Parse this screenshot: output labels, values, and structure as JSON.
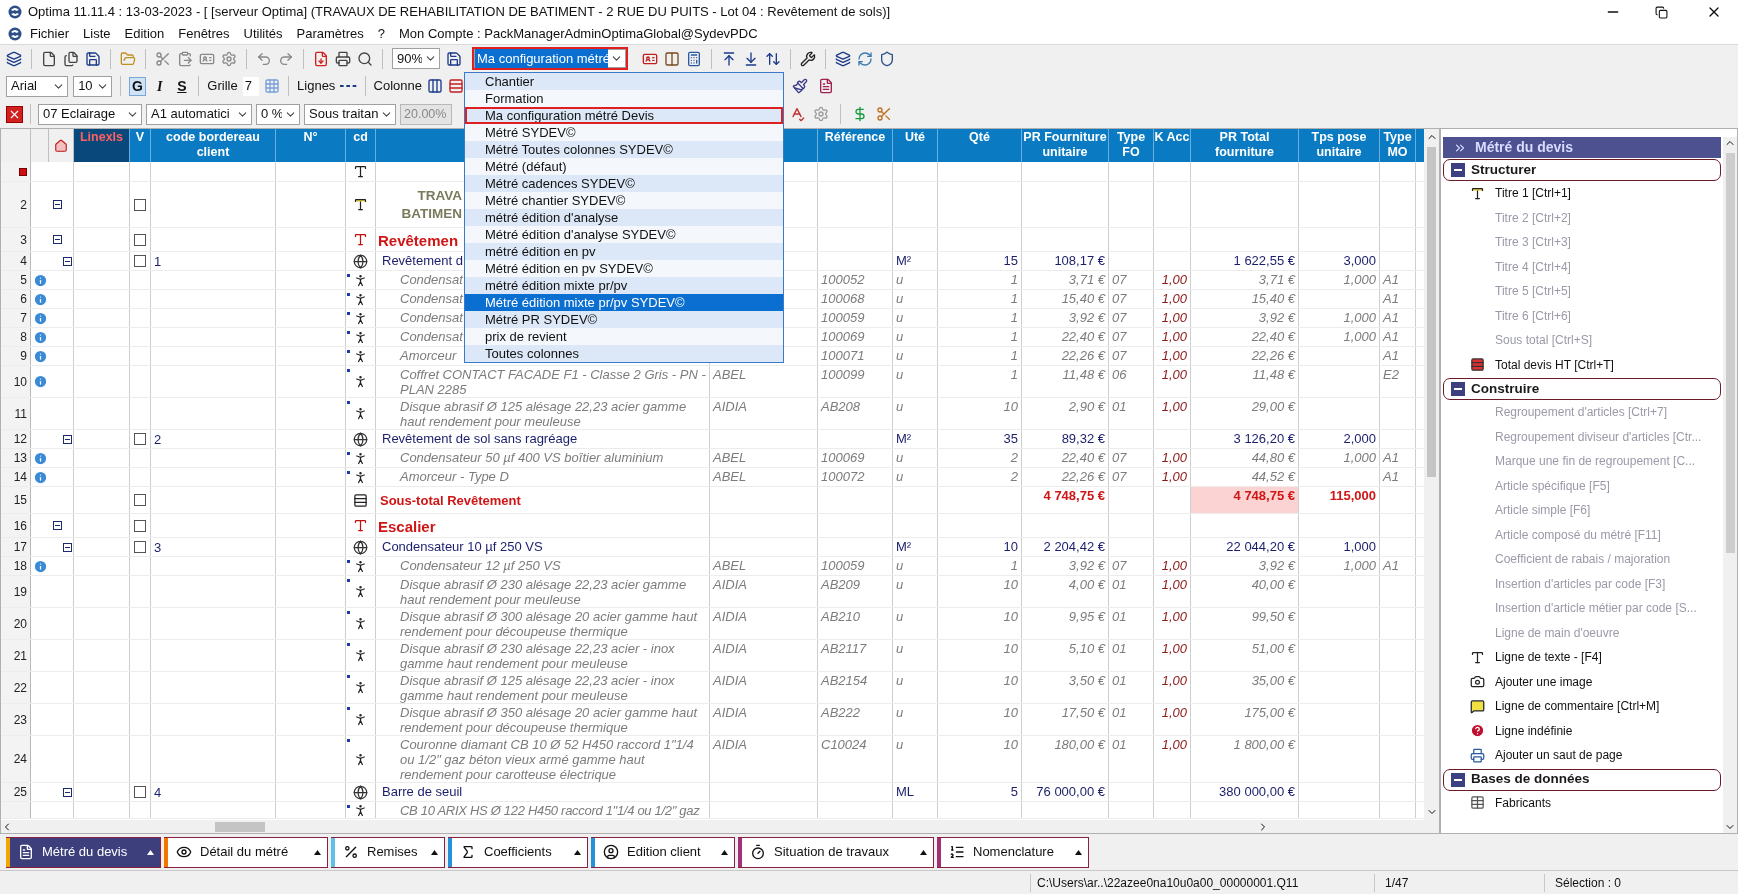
{
  "window": {
    "title": "Optima 11.11.4 : 13-03-2023 - [ [serveur Optima] (TRAVAUX DE REHABILITATION DE BATIMENT - 2 RUE DU PUITS - Lot 04 : Revêtement de sols)]"
  },
  "menu": [
    "Fichier",
    "Liste",
    "Edition",
    "Fenêtres",
    "Utilités",
    "Paramètres",
    "?"
  ],
  "account": "Mon Compte : PackManagerAdminOptimaGlobal@SydevPDC",
  "toolbar": {
    "zoom": "90%",
    "configuration": {
      "value": "Ma configuration métré",
      "outlined": true
    },
    "font": "Arial",
    "font_size": "10",
    "styles": [
      {
        "label": "G",
        "pressed": true
      },
      {
        "label": "I",
        "pressed": false
      },
      {
        "label": "S",
        "pressed": false
      }
    ],
    "grid_label": "Grille",
    "grid_value": "7",
    "lines_label": "Lignes",
    "column_label": "Colonne",
    "lot": "07  Eclairage",
    "mo_type": "A1  automatici",
    "rate": "0 %",
    "subcontract": "Sous traitan",
    "percent": "20.00%"
  },
  "config_menu": [
    {
      "label": "Chantier",
      "selected": false,
      "outlined": false
    },
    {
      "label": "Formation",
      "selected": false,
      "outlined": false
    },
    {
      "label": "Ma configuration métré Devis",
      "selected": false,
      "outlined": true
    },
    {
      "label": "Métré  SYDEV©",
      "selected": false,
      "outlined": false
    },
    {
      "label": "Métré  Toutes colonnes SYDEV©",
      "selected": false,
      "outlined": false
    },
    {
      "label": "Métré (défaut)",
      "selected": false,
      "outlined": false
    },
    {
      "label": "Métré cadences SYDEV©",
      "selected": false,
      "outlined": false
    },
    {
      "label": "Métré chantier SYDEV©",
      "selected": false,
      "outlined": false
    },
    {
      "label": "métré édition d'analyse",
      "selected": false,
      "outlined": false
    },
    {
      "label": "Métré édition d'analyse SYDEV©",
      "selected": false,
      "outlined": false
    },
    {
      "label": "métré édition en pv",
      "selected": false,
      "outlined": false
    },
    {
      "label": "Métré édition en pv SYDEV©",
      "selected": false,
      "outlined": false
    },
    {
      "label": "métré édition mixte pr/pv",
      "selected": false,
      "outlined": false
    },
    {
      "label": "Métré édition mixte pr/pv SYDEV©",
      "selected": true,
      "outlined": false
    },
    {
      "label": "Métré PR SYDEV©",
      "selected": false,
      "outlined": false
    },
    {
      "label": "prix de revient",
      "selected": false,
      "outlined": false
    },
    {
      "label": "Toutes colonnes",
      "selected": false,
      "outlined": false
    }
  ],
  "table": {
    "columns": [
      "Linexls",
      "V",
      "code bordereau client",
      "N°",
      "cd",
      "Référence",
      "Uté",
      "Qté",
      "PR Fourniture unitaire",
      "Type FO",
      "K Acc",
      "PR Total fourniture",
      "Tps pose unitaire",
      "Type MO"
    ],
    "rows": [
      {
        "kind": "text",
        "current": true,
        "info": false
      },
      {
        "num": "2",
        "kind": "title1",
        "current": false,
        "info": false,
        "checked": false,
        "designation_lines": [
          "TRAVA",
          "BATIMEN"
        ]
      },
      {
        "num": "3",
        "kind": "title2",
        "current": false,
        "info": false,
        "checked": false,
        "designation": "Revêtemen"
      },
      {
        "num": "4",
        "kind": "ouvrage",
        "current": false,
        "info": false,
        "checked": false,
        "code": "1",
        "designation": "Revêtement d",
        "unit": "M²",
        "qty": "15",
        "unit_price": "108,17 €",
        "total": "1 622,55 €",
        "time": "3,000"
      },
      {
        "num": "5",
        "kind": "article",
        "current": false,
        "info": true,
        "designation": "Condensat",
        "ref": "100052",
        "unit": "u",
        "qty": "1",
        "unit_price": "3,71 €",
        "type_fo": "07",
        "k_acc": "1,00",
        "total": "3,71 €",
        "time": "1,000",
        "type_mo": "A1"
      },
      {
        "num": "6",
        "kind": "article",
        "current": false,
        "info": true,
        "designation": "Condensat",
        "ref": "100068",
        "unit": "u",
        "qty": "1",
        "unit_price": "15,40 €",
        "type_fo": "07",
        "k_acc": "1,00",
        "total": "15,40 €",
        "type_mo": "A1"
      },
      {
        "num": "7",
        "kind": "article",
        "current": false,
        "info": true,
        "designation": "Condensat",
        "ref": "100059",
        "unit": "u",
        "qty": "1",
        "unit_price": "3,92 €",
        "type_fo": "07",
        "k_acc": "1,00",
        "total": "3,92 €",
        "time": "1,000",
        "type_mo": "A1"
      },
      {
        "num": "8",
        "kind": "article",
        "current": false,
        "info": true,
        "designation": "Condensat",
        "ref": "100069",
        "unit": "u",
        "qty": "1",
        "unit_price": "22,40 €",
        "type_fo": "07",
        "k_acc": "1,00",
        "total": "22,40 €",
        "time": "1,000",
        "type_mo": "A1"
      },
      {
        "num": "9",
        "kind": "article",
        "current": false,
        "info": true,
        "designation": "Amorceur",
        "ref": "100071",
        "unit": "u",
        "qty": "1",
        "unit_price": "22,26 €",
        "type_fo": "07",
        "k_acc": "1,00",
        "total": "22,26 €",
        "type_mo": "A1"
      },
      {
        "num": "10",
        "kind": "article",
        "current": false,
        "info": true,
        "designation": "Coffret CONTACT FACADE F1 - Classe 2 Gris - PN - PLAN 2285",
        "supplier": "ABEL",
        "ref": "100099",
        "unit": "u",
        "qty": "1",
        "unit_price": "11,48 €",
        "type_fo": "06",
        "k_acc": "1,00",
        "total": "11,48 €",
        "type_mo": "E2"
      },
      {
        "num": "11",
        "kind": "article",
        "current": false,
        "info": false,
        "designation": "Disque abrasif Ø 125 alésage 22,23 acier gamme haut rendement pour meuleuse",
        "supplier": "AIDIA",
        "ref": "AB208",
        "unit": "u",
        "qty": "10",
        "unit_price": "2,90 €",
        "type_fo": "01",
        "k_acc": "1,00",
        "total": "29,00 €"
      },
      {
        "num": "12",
        "kind": "ouvrage",
        "current": false,
        "info": false,
        "checked": false,
        "code": "2",
        "designation": "Revêtement de sol sans ragréage",
        "unit": "M²",
        "qty": "35",
        "unit_price": "89,32 €",
        "total": "3 126,20 €",
        "time": "2,000"
      },
      {
        "num": "13",
        "kind": "article",
        "current": false,
        "info": true,
        "designation": "Condensateur 50 µf 400 VS boîtier aluminium",
        "supplier": "ABEL",
        "ref": "100069",
        "unit": "u",
        "qty": "2",
        "unit_price": "22,40 €",
        "type_fo": "07",
        "k_acc": "1,00",
        "total": "44,80 €",
        "time": "1,000",
        "type_mo": "A1"
      },
      {
        "num": "14",
        "kind": "article",
        "current": false,
        "info": true,
        "designation": "Amorceur  - Type D",
        "supplier": "ABEL",
        "ref": "100072",
        "unit": "u",
        "qty": "2",
        "unit_price": "22,26 €",
        "type_fo": "07",
        "k_acc": "1,00",
        "total": "44,52 €",
        "type_mo": "A1"
      },
      {
        "num": "15",
        "kind": "subtotal",
        "current": false,
        "info": false,
        "checked": false,
        "designation": "Sous-total Revêtement",
        "unit_price": "4 748,75 €",
        "total": "4 748,75 €",
        "time": "115,000"
      },
      {
        "num": "16",
        "kind": "title2",
        "current": false,
        "info": false,
        "checked": false,
        "designation": "Escalier"
      },
      {
        "num": "17",
        "kind": "ouvrage",
        "current": false,
        "info": false,
        "checked": false,
        "code": "3",
        "designation": "Condensateur 10 µf 250 VS",
        "unit": "M²",
        "qty": "10",
        "unit_price": "2 204,42 €",
        "total": "22 044,20 €",
        "time": "1,000"
      },
      {
        "num": "18",
        "kind": "article",
        "current": false,
        "info": true,
        "designation": "Condensateur 12 µf 250 VS",
        "supplier": "ABEL",
        "ref": "100059",
        "unit": "u",
        "qty": "1",
        "unit_price": "3,92 €",
        "type_fo": "07",
        "k_acc": "1,00",
        "total": "3,92 €",
        "time": "1,000",
        "type_mo": "A1"
      },
      {
        "num": "19",
        "kind": "article",
        "current": false,
        "info": false,
        "designation": "Disque abrasif Ø 230 alésage 22,23 acier gamme haut rendement pour meuleuse",
        "supplier": "AIDIA",
        "ref": "AB209",
        "unit": "u",
        "qty": "10",
        "unit_price": "4,00 €",
        "type_fo": "01",
        "k_acc": "1,00",
        "total": "40,00 €"
      },
      {
        "num": "20",
        "kind": "article",
        "current": false,
        "info": false,
        "designation": "Disque abrasif Ø 300 alésage 20 acier gamme haut rendement pour découpeuse thermique",
        "supplier": "AIDIA",
        "ref": "AB210",
        "unit": "u",
        "qty": "10",
        "unit_price": "9,95 €",
        "type_fo": "01",
        "k_acc": "1,00",
        "total": "99,50 €"
      },
      {
        "num": "21",
        "kind": "article",
        "current": false,
        "info": false,
        "designation": "Disque abrasif Ø 230 alésage 22,23 acier - inox gamme haut rendement pour meuleuse",
        "supplier": "AIDIA",
        "ref": "AB2117",
        "unit": "u",
        "qty": "10",
        "unit_price": "5,10 €",
        "type_fo": "01",
        "k_acc": "1,00",
        "total": "51,00 €"
      },
      {
        "num": "22",
        "kind": "article",
        "current": false,
        "info": false,
        "designation": "Disque abrasif Ø 125 alésage 22,23 acier - inox gamme haut rendement pour meuleuse",
        "supplier": "AIDIA",
        "ref": "AB2154",
        "unit": "u",
        "qty": "10",
        "unit_price": "3,50 €",
        "type_fo": "01",
        "k_acc": "1,00",
        "total": "35,00 €"
      },
      {
        "num": "23",
        "kind": "article",
        "current": false,
        "info": false,
        "designation": "Disque abrasif Ø 350 alésage 20 acier gamme haut rendement pour découpeuse thermique",
        "supplier": "AIDIA",
        "ref": "AB222",
        "unit": "u",
        "qty": "10",
        "unit_price": "17,50 €",
        "type_fo": "01",
        "k_acc": "1,00",
        "total": "175,00 €"
      },
      {
        "num": "24",
        "kind": "article",
        "current": false,
        "info": false,
        "designation": "Couronne diamant CB 10 Ø 52 H450 raccord 1\"1/4 ou 1/2\" gaz béton vieux armé gamme haut rendement pour carotteuse électrique",
        "supplier": "AIDIA",
        "ref": "C10024",
        "unit": "u",
        "qty": "10",
        "unit_price": "180,00 €",
        "type_fo": "01",
        "k_acc": "1,00",
        "total": "1 800,00 €"
      },
      {
        "num": "25",
        "kind": "ouvrage",
        "current": false,
        "info": false,
        "checked": false,
        "code": "4",
        "designation": "Barre de seuil",
        "unit": "ML",
        "qty": "5",
        "unit_price": "76 000,00 €",
        "total": "380 000,00 €"
      },
      {
        "kind": "article",
        "current": false,
        "info": false,
        "designation": "CB 10 ARIX HS Ø 122 H450 raccord 1\"1/4 ou 1/2\" gaz"
      }
    ]
  },
  "sidebar": {
    "title": "Métré du devis",
    "sections": [
      {
        "title": "Structurer",
        "expanded": true,
        "items": [
          {
            "label": "Titre 1 [Ctrl+1]",
            "kind": "title1",
            "enabled": true
          },
          {
            "label": "Titre 2 [Ctrl+2]",
            "kind": "plain",
            "enabled": false
          },
          {
            "label": "Titre 3 [Ctrl+3]",
            "kind": "plain",
            "enabled": false
          },
          {
            "label": "Titre 4 [Ctrl+4]",
            "kind": "plain",
            "enabled": false
          },
          {
            "label": "Titre 5 [Ctrl+5]",
            "kind": "plain",
            "enabled": false
          },
          {
            "label": "Titre 6 [Ctrl+6]",
            "kind": "plain",
            "enabled": false
          },
          {
            "label": "Sous total [Ctrl+S]",
            "kind": "plain",
            "enabled": false
          },
          {
            "label": "Total devis HT [Ctrl+T]",
            "kind": "total",
            "enabled": true
          }
        ]
      },
      {
        "title": "Construire",
        "expanded": true,
        "items": [
          {
            "label": "Regroupement d'articles  [Ctrl+7]",
            "kind": "plain",
            "enabled": false
          },
          {
            "label": "Regroupement diviseur d'articles [Ctr...",
            "kind": "plain",
            "enabled": false
          },
          {
            "label": "Marque une fin de regroupement  [C...",
            "kind": "plain",
            "enabled": false
          },
          {
            "label": "Article spécifique [F5]",
            "kind": "plain",
            "enabled": false
          },
          {
            "label": "Article simple [F6]",
            "kind": "plain",
            "enabled": false
          },
          {
            "label": "Article composé du métré [F11]",
            "kind": "plain",
            "enabled": false
          },
          {
            "label": "Coefficient de rabais / majoration",
            "kind": "plain",
            "enabled": false
          },
          {
            "label": "Insertion d'articles par code [F3]",
            "kind": "plain",
            "enabled": false
          },
          {
            "label": "Insertion d'article métier par code [S...",
            "kind": "plain",
            "enabled": false
          },
          {
            "label": "Ligne de main d'oeuvre",
            "kind": "plain",
            "enabled": false
          },
          {
            "label": "Ligne de texte - [F4]",
            "kind": "text",
            "enabled": true
          },
          {
            "label": "Ajouter une image",
            "kind": "image",
            "enabled": true
          },
          {
            "label": "Ligne de commentaire [Ctrl+M]",
            "kind": "comment",
            "enabled": true
          },
          {
            "label": "Ligne indéfinie",
            "kind": "undefined",
            "enabled": true
          },
          {
            "label": "Ajouter un saut de page",
            "kind": "pagebreak",
            "enabled": true
          }
        ]
      },
      {
        "title": "Bases de données",
        "expanded": true,
        "items": [
          {
            "label": "Fabricants",
            "kind": "database",
            "enabled": true
          }
        ]
      }
    ]
  },
  "bottom_tabs": [
    {
      "label": "Métré du devis",
      "selected": true,
      "color": "#f0a800"
    },
    {
      "label": "Détail du métré",
      "selected": false,
      "color": "#f07800"
    },
    {
      "label": "Remises",
      "selected": false,
      "color": "#60c0e8"
    },
    {
      "label": "Coefficients",
      "selected": false,
      "color": "#2890d8"
    },
    {
      "label": "Edition client",
      "selected": false,
      "color": "#2890d8"
    },
    {
      "label": "Situation de travaux",
      "selected": false,
      "color": "#a03078"
    },
    {
      "label": "Nomenclature",
      "selected": false,
      "color": "#a03078"
    }
  ],
  "status_bar": {
    "path": "C:\\Users\\ar..\\22azee0na10u0a00_00000001.Q11",
    "page": "1/47",
    "selection": "Sélection : 0"
  }
}
